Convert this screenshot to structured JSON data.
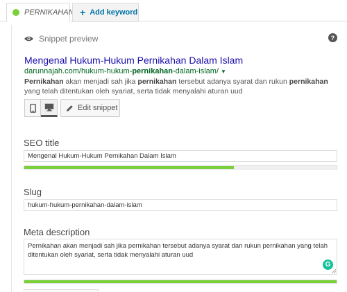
{
  "tabs": {
    "active_label": "PERNIKAHAN",
    "add_label": "Add keyword"
  },
  "snippet": {
    "header_label": "Snippet preview",
    "title": "Mengenal Hukum-Hukum Pernikahan Dalam Islam",
    "url_prefix": "darunnajah.com/hukum-hukum-",
    "url_keyword": "pernikahan",
    "url_suffix": "-dalam-islam/",
    "desc_kw1": "Pernikahan",
    "desc_part1": " akan menjadi sah jika ",
    "desc_kw2": "pernikahan",
    "desc_part2": " tersebut adanya syarat dan rukun ",
    "desc_kw3": "pernikahan",
    "desc_part3": " yang telah ditentukan oleh syariat, serta tidak menyalahi aturan uud",
    "edit_label": "Edit snippet"
  },
  "seo_title": {
    "label": "SEO title",
    "value": "Mengenal Hukum-Hukum Pernikahan Dalam Islam",
    "progress": 0.67
  },
  "slug": {
    "label": "Slug",
    "value": "hukum-hukum-pernikahan-dalam-islam"
  },
  "meta": {
    "label": "Meta description",
    "value": "Pernikahan akan menjadi sah jika pernikahan tersebut adanya syarat dan rukun pernikahan yang telah ditentukan oleh syariat, serta tidak menyalahi aturan uud",
    "progress": 1.0
  },
  "colors": {
    "status_green": "#7ad03a",
    "link_blue": "#1a0dab",
    "url_green": "#006621",
    "accent_blue": "#0073aa"
  },
  "icons": [
    "eye-icon",
    "help-icon",
    "mobile-icon",
    "desktop-icon",
    "pencil-icon",
    "grammarly-icon"
  ]
}
